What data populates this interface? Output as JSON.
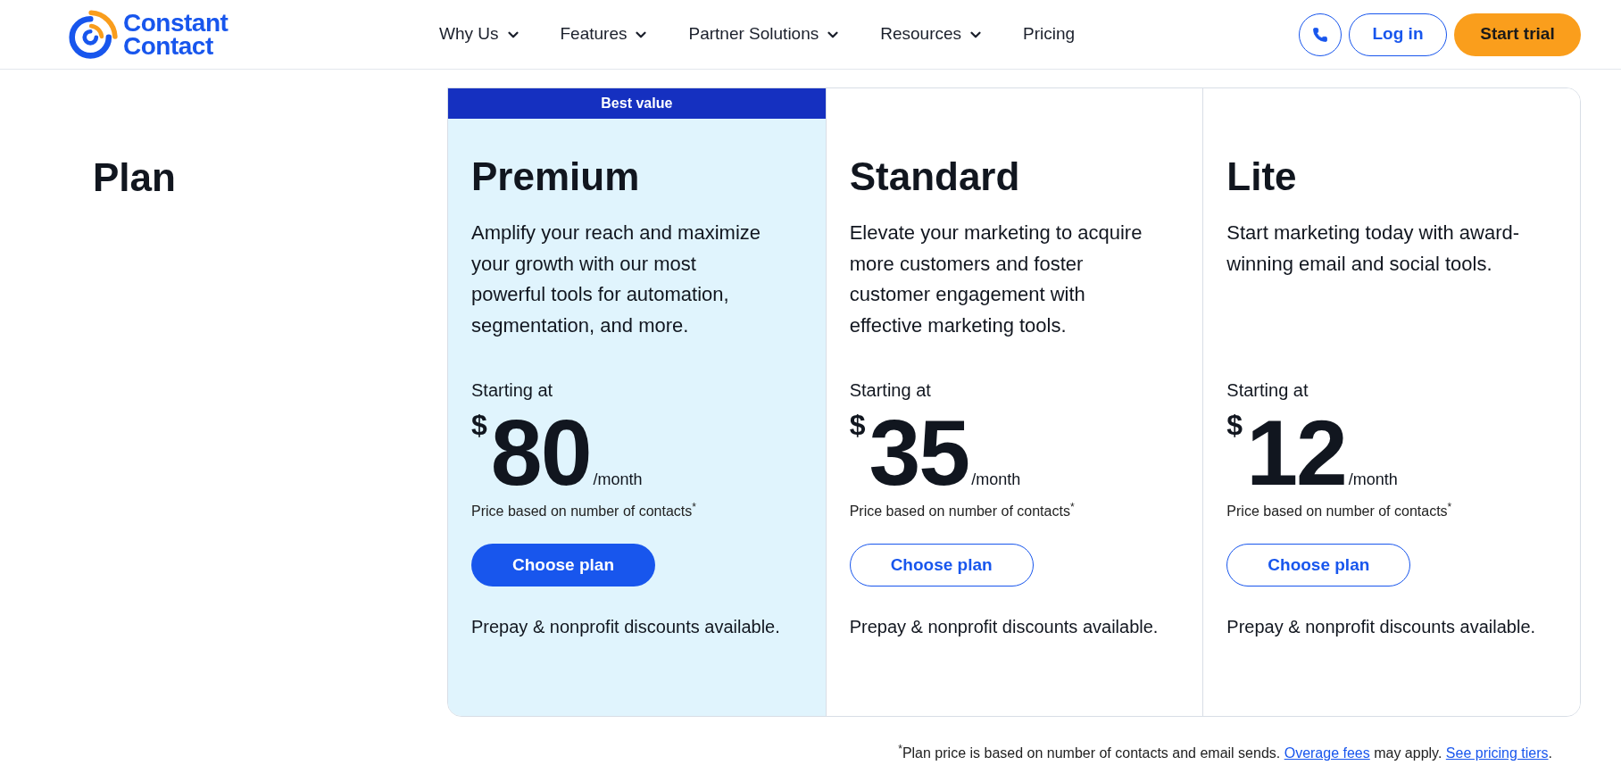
{
  "header": {
    "logo": {
      "lines": [
        "Constant",
        "Contact"
      ]
    },
    "nav": [
      {
        "label": "Why Us",
        "has_menu": true
      },
      {
        "label": "Features",
        "has_menu": true
      },
      {
        "label": "Partner Solutions",
        "has_menu": true
      },
      {
        "label": "Resources",
        "has_menu": true
      },
      {
        "label": "Pricing",
        "has_menu": false
      }
    ],
    "login_button": "Log in",
    "trial_button": "Start trial"
  },
  "plans": {
    "heading": "Plan",
    "columns": [
      {
        "featured": true,
        "badge": "Best value",
        "name": "Premium",
        "description": "Amplify your reach and maximize your growth with our most powerful tools for automation, segmentation, and more.",
        "price_label": "Starting at",
        "currency": "$",
        "amount": "80",
        "period": "/month",
        "price_note": "Price based on number of contacts$^{*}$",
        "button": "Choose plan",
        "discount_note": "Prepay & nonprofit discounts available."
      },
      {
        "featured": false,
        "name": "Standard",
        "description": "Elevate your marketing to acquire more customers and foster customer engagement with effective marketing tools.",
        "price_label": "Starting at",
        "currency": "$",
        "amount": "35",
        "period": "/month",
        "price_note": "Price based on number of contacts$^{*}$",
        "button": "Choose plan",
        "discount_note": "Prepay & nonprofit discounts available."
      },
      {
        "featured": false,
        "name": "Lite",
        "description": "Start marketing today with award-winning email and social tools.",
        "price_label": "Starting at",
        "currency": "$",
        "amount": "12",
        "period": "/month",
        "price_note": "Price based on number of contacts$^{*}$",
        "button": "Choose plan",
        "discount_note": "Prepay & nonprofit discounts available."
      }
    ]
  },
  "footnote": {
    "parts": [
      {
        "kind": "text",
        "text": "$^{*}$Plan price is based on number of contacts and email sends. "
      },
      {
        "kind": "link",
        "text": "Overage fees"
      },
      {
        "kind": "text",
        "text": " may apply. "
      },
      {
        "kind": "link",
        "text": "See pricing tiers"
      },
      {
        "kind": "text",
        "text": "."
      }
    ]
  }
}
